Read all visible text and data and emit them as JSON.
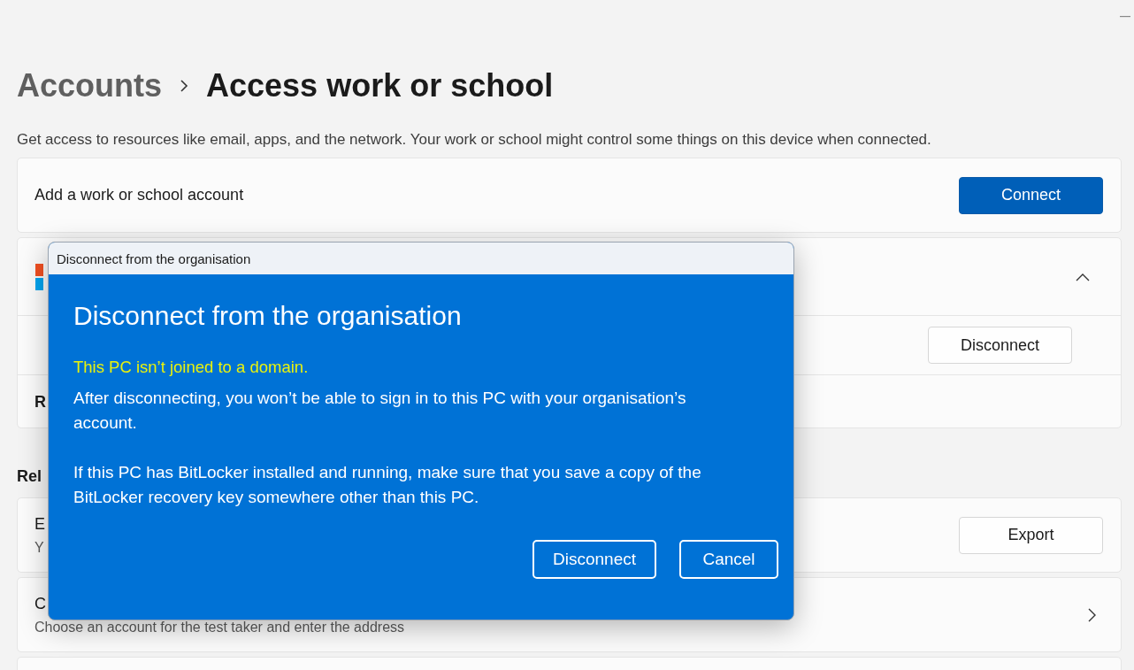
{
  "breadcrumb": [
    {
      "label": "Accounts",
      "current": false
    },
    {
      "label": "Access work or school",
      "current": true
    }
  ],
  "description": "Get access to resources like email, apps, and the network. Your work or school might control some things on this device when connected.",
  "add_account": {
    "label": "Add a work or school account",
    "button": "Connect"
  },
  "account_card": {
    "expanded": true,
    "rows": [
      {
        "kind": "button",
        "button": "Disconnect"
      },
      {
        "kind": "text",
        "label": "R"
      }
    ]
  },
  "related_heading": "Rel",
  "related": [
    {
      "kind": "button",
      "title": "E",
      "subtitle": "Y",
      "button": "Export"
    },
    {
      "kind": "link",
      "title": "C",
      "subtitle": "Choose an account for the test taker and enter the address"
    }
  ],
  "dialog": {
    "title_bar": "Disconnect from the organisation",
    "heading": "Disconnect from the organisation",
    "warning": "This PC isn’t joined to a domain.",
    "paragraphs": [
      "After disconnecting, you won’t be able to sign in to this PC with your organisation’s account.",
      "If this PC has BitLocker installed and running, make sure that you save a copy of the BitLocker recovery key somewhere other than this PC."
    ],
    "buttons": [
      {
        "label": "Disconnect"
      },
      {
        "label": "Cancel"
      }
    ]
  }
}
